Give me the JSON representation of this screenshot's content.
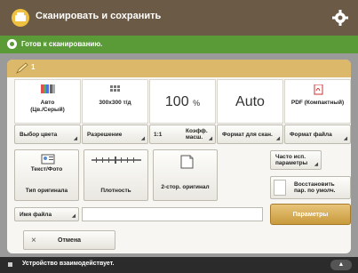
{
  "header": {
    "title": "Сканировать и сохранить",
    "app_icon": "scan-save-icon",
    "settings_icon": "gear-icon"
  },
  "status": {
    "text": "Готов к сканированию."
  },
  "panel": {
    "head_number": "1"
  },
  "summary": {
    "color": {
      "line1": "Авто",
      "line2": "(Цв./Серый)"
    },
    "resolution": {
      "text": "300x300 т/д"
    },
    "ratio": {
      "value": "100",
      "unit": "%"
    },
    "size": {
      "value": "Auto"
    },
    "format": {
      "text": "PDF (Компактный)"
    }
  },
  "settings_row": {
    "color_select": "Выбор цвета",
    "resolution": "Разрешение",
    "ratio_prefix": "1:1",
    "ratio": "Коэфф. масш.",
    "original_size": "Формат для скан.",
    "file_format": "Формат файла"
  },
  "tiles": {
    "original_type": {
      "top": "Текст/Фото",
      "bottom": "Тип оригинала"
    },
    "density": "Плотность",
    "duplex": "2-стор. оригинал",
    "frequent": "Часто исп. параметры",
    "restore": "Восстановить пар. по умолч."
  },
  "file_name": {
    "label": "Имя файла",
    "value": ""
  },
  "options": {
    "label": "Параметры"
  },
  "cancel": {
    "label": "Отмена"
  },
  "footer": {
    "text": "Устройство взаимодействует."
  },
  "colors": {
    "titlebar": "#6b5a45",
    "status": "#5a9a37",
    "accent": "#dcb86a"
  }
}
